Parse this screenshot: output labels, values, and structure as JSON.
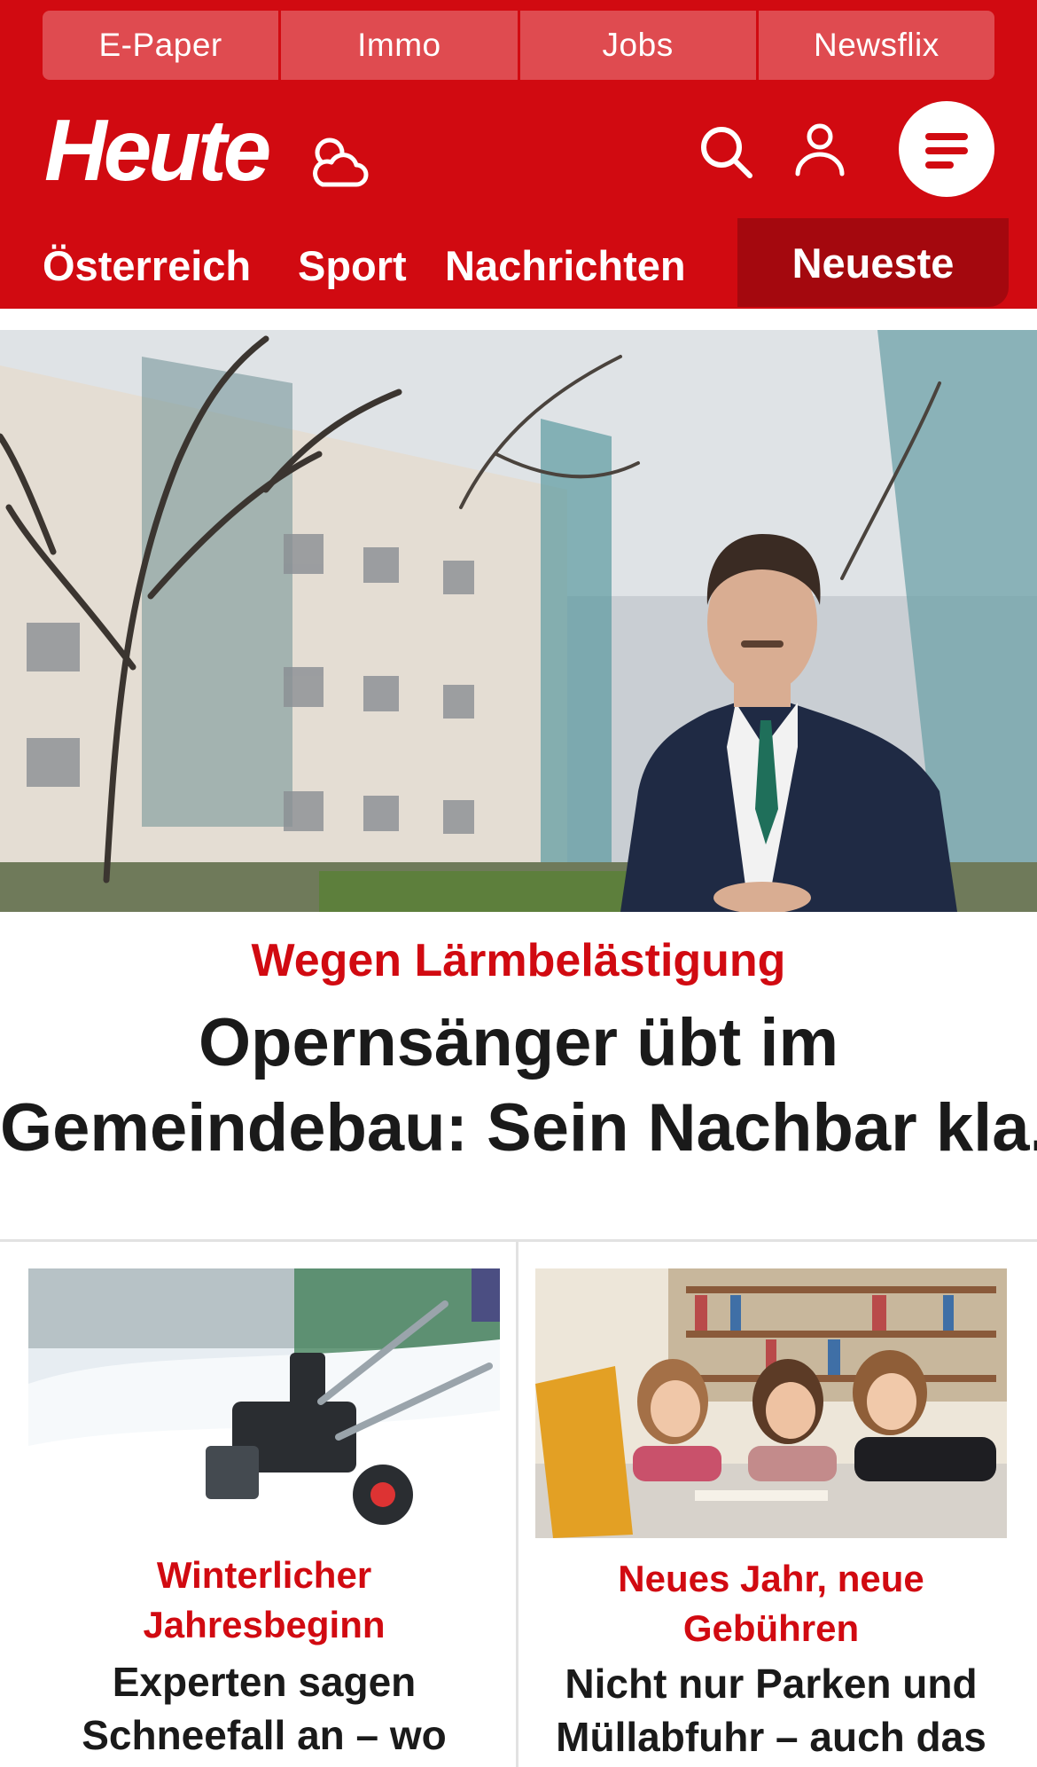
{
  "colors": {
    "brand": "#d10a11",
    "brand_dark": "#a4080e",
    "utility_bg": "#df4b50",
    "text": "#1a1a1a"
  },
  "utility_bar": {
    "items": [
      "E-Paper",
      "Immo",
      "Jobs",
      "Newsflix"
    ]
  },
  "masthead": {
    "logo_text": "Heute",
    "icons": [
      "weather-icon",
      "search-icon",
      "user-icon",
      "hamburger-menu-icon"
    ]
  },
  "nav": {
    "items": [
      "Österreich",
      "Sport",
      "Nachrichten"
    ],
    "highlight": "Neueste"
  },
  "hero": {
    "kicker": "Wegen Lärmbelästigung",
    "headline_lines": [
      "Opernsänger übt im",
      "Gemeindebau: Sein Nachbar kla..."
    ]
  },
  "cards": [
    {
      "kicker_lines": [
        "Winterlicher",
        "Jahresbeginn"
      ],
      "title_lines": [
        "Experten sagen",
        "Schneefall an – wo"
      ]
    },
    {
      "kicker_lines": [
        "Neues Jahr, neue",
        "Gebühren"
      ],
      "title_lines": [
        "Nicht nur Parken und",
        "Müllabfuhr – auch das"
      ]
    }
  ]
}
